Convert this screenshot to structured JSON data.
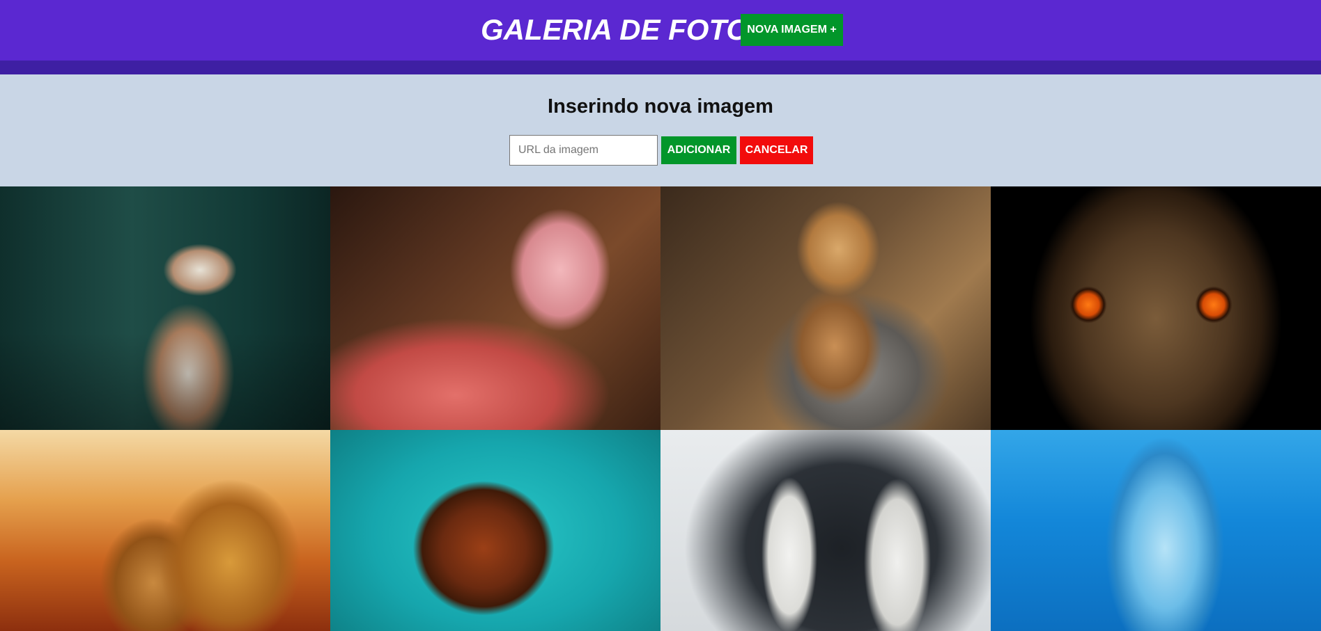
{
  "header": {
    "title": "GALERIA DE FOTOS",
    "new_image_button": "NOVA IMAGEM +"
  },
  "form": {
    "title": "Inserindo nova imagem",
    "url_placeholder": "URL da imagem",
    "url_value": "",
    "add_button": "ADICIONAR",
    "cancel_button": "CANCELAR"
  },
  "colors": {
    "header_bg": "#5b28d1",
    "header_stripe": "#3e1fa3",
    "form_bg": "#c9d6e6",
    "add_green": "#02962a",
    "cancel_red": "#f20c0c"
  },
  "gallery": {
    "images": [
      {
        "subject": "cat"
      },
      {
        "subject": "flamingo"
      },
      {
        "subject": "puppies"
      },
      {
        "subject": "owl"
      },
      {
        "subject": "lions"
      },
      {
        "subject": "sea turtle"
      },
      {
        "subject": "penguins"
      },
      {
        "subject": "dolphin"
      }
    ]
  }
}
